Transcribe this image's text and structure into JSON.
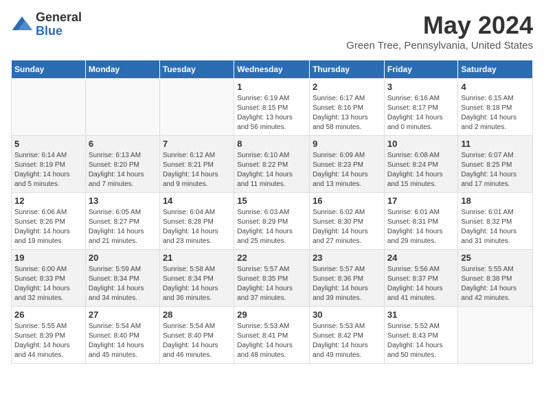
{
  "logo": {
    "general": "General",
    "blue": "Blue"
  },
  "title": "May 2024",
  "location": "Green Tree, Pennsylvania, United States",
  "days_of_week": [
    "Sunday",
    "Monday",
    "Tuesday",
    "Wednesday",
    "Thursday",
    "Friday",
    "Saturday"
  ],
  "weeks": [
    [
      {
        "day": "",
        "info": ""
      },
      {
        "day": "",
        "info": ""
      },
      {
        "day": "",
        "info": ""
      },
      {
        "day": "1",
        "info": "Sunrise: 6:19 AM\nSunset: 8:15 PM\nDaylight: 13 hours\nand 56 minutes."
      },
      {
        "day": "2",
        "info": "Sunrise: 6:17 AM\nSunset: 8:16 PM\nDaylight: 13 hours\nand 58 minutes."
      },
      {
        "day": "3",
        "info": "Sunrise: 6:16 AM\nSunset: 8:17 PM\nDaylight: 14 hours\nand 0 minutes."
      },
      {
        "day": "4",
        "info": "Sunrise: 6:15 AM\nSunset: 8:18 PM\nDaylight: 14 hours\nand 2 minutes."
      }
    ],
    [
      {
        "day": "5",
        "info": "Sunrise: 6:14 AM\nSunset: 8:19 PM\nDaylight: 14 hours\nand 5 minutes."
      },
      {
        "day": "6",
        "info": "Sunrise: 6:13 AM\nSunset: 8:20 PM\nDaylight: 14 hours\nand 7 minutes."
      },
      {
        "day": "7",
        "info": "Sunrise: 6:12 AM\nSunset: 8:21 PM\nDaylight: 14 hours\nand 9 minutes."
      },
      {
        "day": "8",
        "info": "Sunrise: 6:10 AM\nSunset: 8:22 PM\nDaylight: 14 hours\nand 11 minutes."
      },
      {
        "day": "9",
        "info": "Sunrise: 6:09 AM\nSunset: 8:23 PM\nDaylight: 14 hours\nand 13 minutes."
      },
      {
        "day": "10",
        "info": "Sunrise: 6:08 AM\nSunset: 8:24 PM\nDaylight: 14 hours\nand 15 minutes."
      },
      {
        "day": "11",
        "info": "Sunrise: 6:07 AM\nSunset: 8:25 PM\nDaylight: 14 hours\nand 17 minutes."
      }
    ],
    [
      {
        "day": "12",
        "info": "Sunrise: 6:06 AM\nSunset: 8:26 PM\nDaylight: 14 hours\nand 19 minutes."
      },
      {
        "day": "13",
        "info": "Sunrise: 6:05 AM\nSunset: 8:27 PM\nDaylight: 14 hours\nand 21 minutes."
      },
      {
        "day": "14",
        "info": "Sunrise: 6:04 AM\nSunset: 8:28 PM\nDaylight: 14 hours\nand 23 minutes."
      },
      {
        "day": "15",
        "info": "Sunrise: 6:03 AM\nSunset: 8:29 PM\nDaylight: 14 hours\nand 25 minutes."
      },
      {
        "day": "16",
        "info": "Sunrise: 6:02 AM\nSunset: 8:30 PM\nDaylight: 14 hours\nand 27 minutes."
      },
      {
        "day": "17",
        "info": "Sunrise: 6:01 AM\nSunset: 8:31 PM\nDaylight: 14 hours\nand 29 minutes."
      },
      {
        "day": "18",
        "info": "Sunrise: 6:01 AM\nSunset: 8:32 PM\nDaylight: 14 hours\nand 31 minutes."
      }
    ],
    [
      {
        "day": "19",
        "info": "Sunrise: 6:00 AM\nSunset: 8:33 PM\nDaylight: 14 hours\nand 32 minutes."
      },
      {
        "day": "20",
        "info": "Sunrise: 5:59 AM\nSunset: 8:34 PM\nDaylight: 14 hours\nand 34 minutes."
      },
      {
        "day": "21",
        "info": "Sunrise: 5:58 AM\nSunset: 8:34 PM\nDaylight: 14 hours\nand 36 minutes."
      },
      {
        "day": "22",
        "info": "Sunrise: 5:57 AM\nSunset: 8:35 PM\nDaylight: 14 hours\nand 37 minutes."
      },
      {
        "day": "23",
        "info": "Sunrise: 5:57 AM\nSunset: 8:36 PM\nDaylight: 14 hours\nand 39 minutes."
      },
      {
        "day": "24",
        "info": "Sunrise: 5:56 AM\nSunset: 8:37 PM\nDaylight: 14 hours\nand 41 minutes."
      },
      {
        "day": "25",
        "info": "Sunrise: 5:55 AM\nSunset: 8:38 PM\nDaylight: 14 hours\nand 42 minutes."
      }
    ],
    [
      {
        "day": "26",
        "info": "Sunrise: 5:55 AM\nSunset: 8:39 PM\nDaylight: 14 hours\nand 44 minutes."
      },
      {
        "day": "27",
        "info": "Sunrise: 5:54 AM\nSunset: 8:40 PM\nDaylight: 14 hours\nand 45 minutes."
      },
      {
        "day": "28",
        "info": "Sunrise: 5:54 AM\nSunset: 8:40 PM\nDaylight: 14 hours\nand 46 minutes."
      },
      {
        "day": "29",
        "info": "Sunrise: 5:53 AM\nSunset: 8:41 PM\nDaylight: 14 hours\nand 48 minutes."
      },
      {
        "day": "30",
        "info": "Sunrise: 5:53 AM\nSunset: 8:42 PM\nDaylight: 14 hours\nand 49 minutes."
      },
      {
        "day": "31",
        "info": "Sunrise: 5:52 AM\nSunset: 8:43 PM\nDaylight: 14 hours\nand 50 minutes."
      },
      {
        "day": "",
        "info": ""
      }
    ]
  ]
}
